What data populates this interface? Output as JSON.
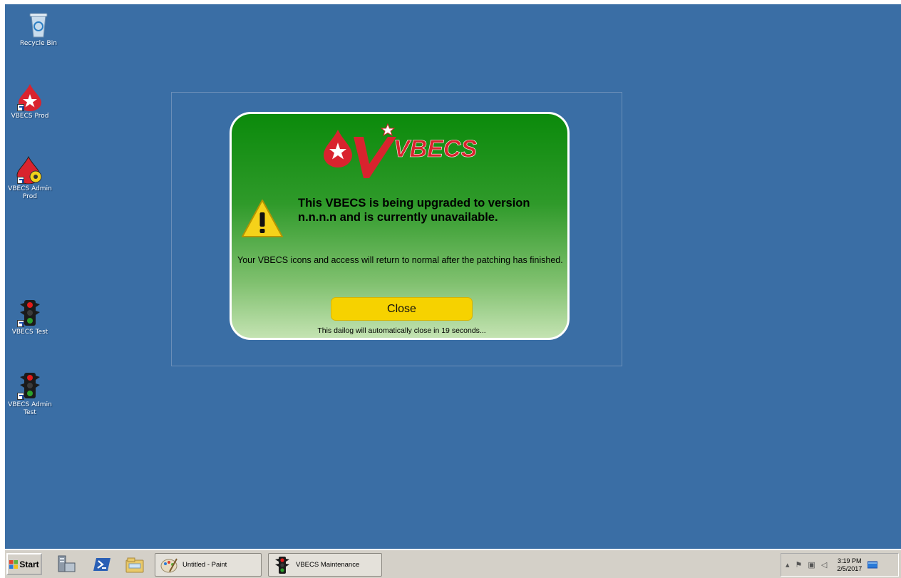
{
  "desktop_icons": [
    {
      "label": "Recycle Bin",
      "icon": "recycle-bin-icon"
    },
    {
      "label": "VBECS Prod",
      "icon": "vbecs-drop-icon"
    },
    {
      "label": "VBECS Admin Prod",
      "icon": "vbecs-admin-icon"
    },
    {
      "label": "VBECS Test",
      "icon": "traffic-light-icon"
    },
    {
      "label": "VBECS Admin Test",
      "icon": "traffic-light-icon"
    }
  ],
  "dialog": {
    "logo_text": "VBECS",
    "headline": "This VBECS is being upgraded to version n.n.n.n and is currently unavailable.",
    "body": "Your VBECS icons and access will return to normal after the patching has finished.",
    "close_label": "Close",
    "countdown": "This dailog will automatically close in 19 seconds..."
  },
  "taskbar": {
    "start_label": "Start",
    "quicklaunch": [
      "server-manager-icon",
      "powershell-icon",
      "explorer-icon"
    ],
    "tasks": [
      {
        "label": "Untitled - Paint",
        "icon": "paint-icon"
      },
      {
        "label": "VBECS Maintenance",
        "icon": "traffic-light-icon"
      }
    ],
    "tray": {
      "time": "3:19 PM",
      "date": "2/5/2017"
    }
  },
  "colors": {
    "desktop": "#3a6ea5",
    "dialog_top": "#0b8a0b",
    "close_button": "#f6d200",
    "logo_red": "#d9232e"
  }
}
